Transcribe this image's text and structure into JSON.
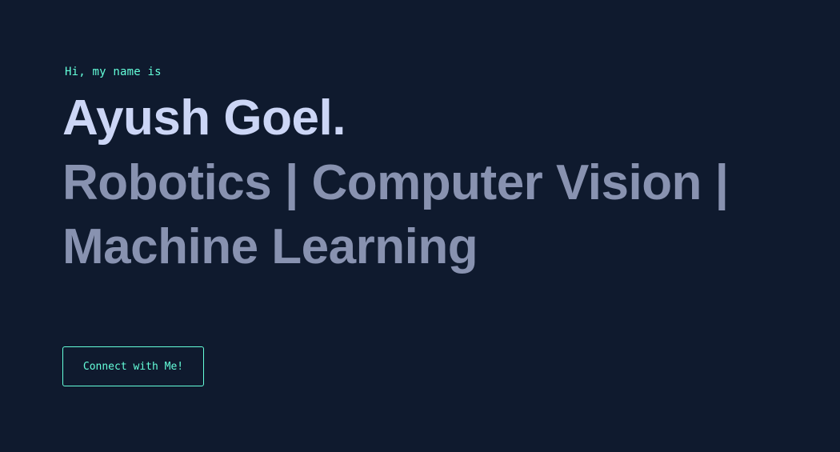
{
  "hero": {
    "intro": "Hi, my name is",
    "name": "Ayush Goel.",
    "tagline": "Robotics | Computer Vision | Machine Learning",
    "cta_label": "Connect with Me!"
  },
  "colors": {
    "background": "#0f1a2e",
    "accent": "#64ffda",
    "heading": "#ccd6f6",
    "subheading": "#8892b0"
  }
}
